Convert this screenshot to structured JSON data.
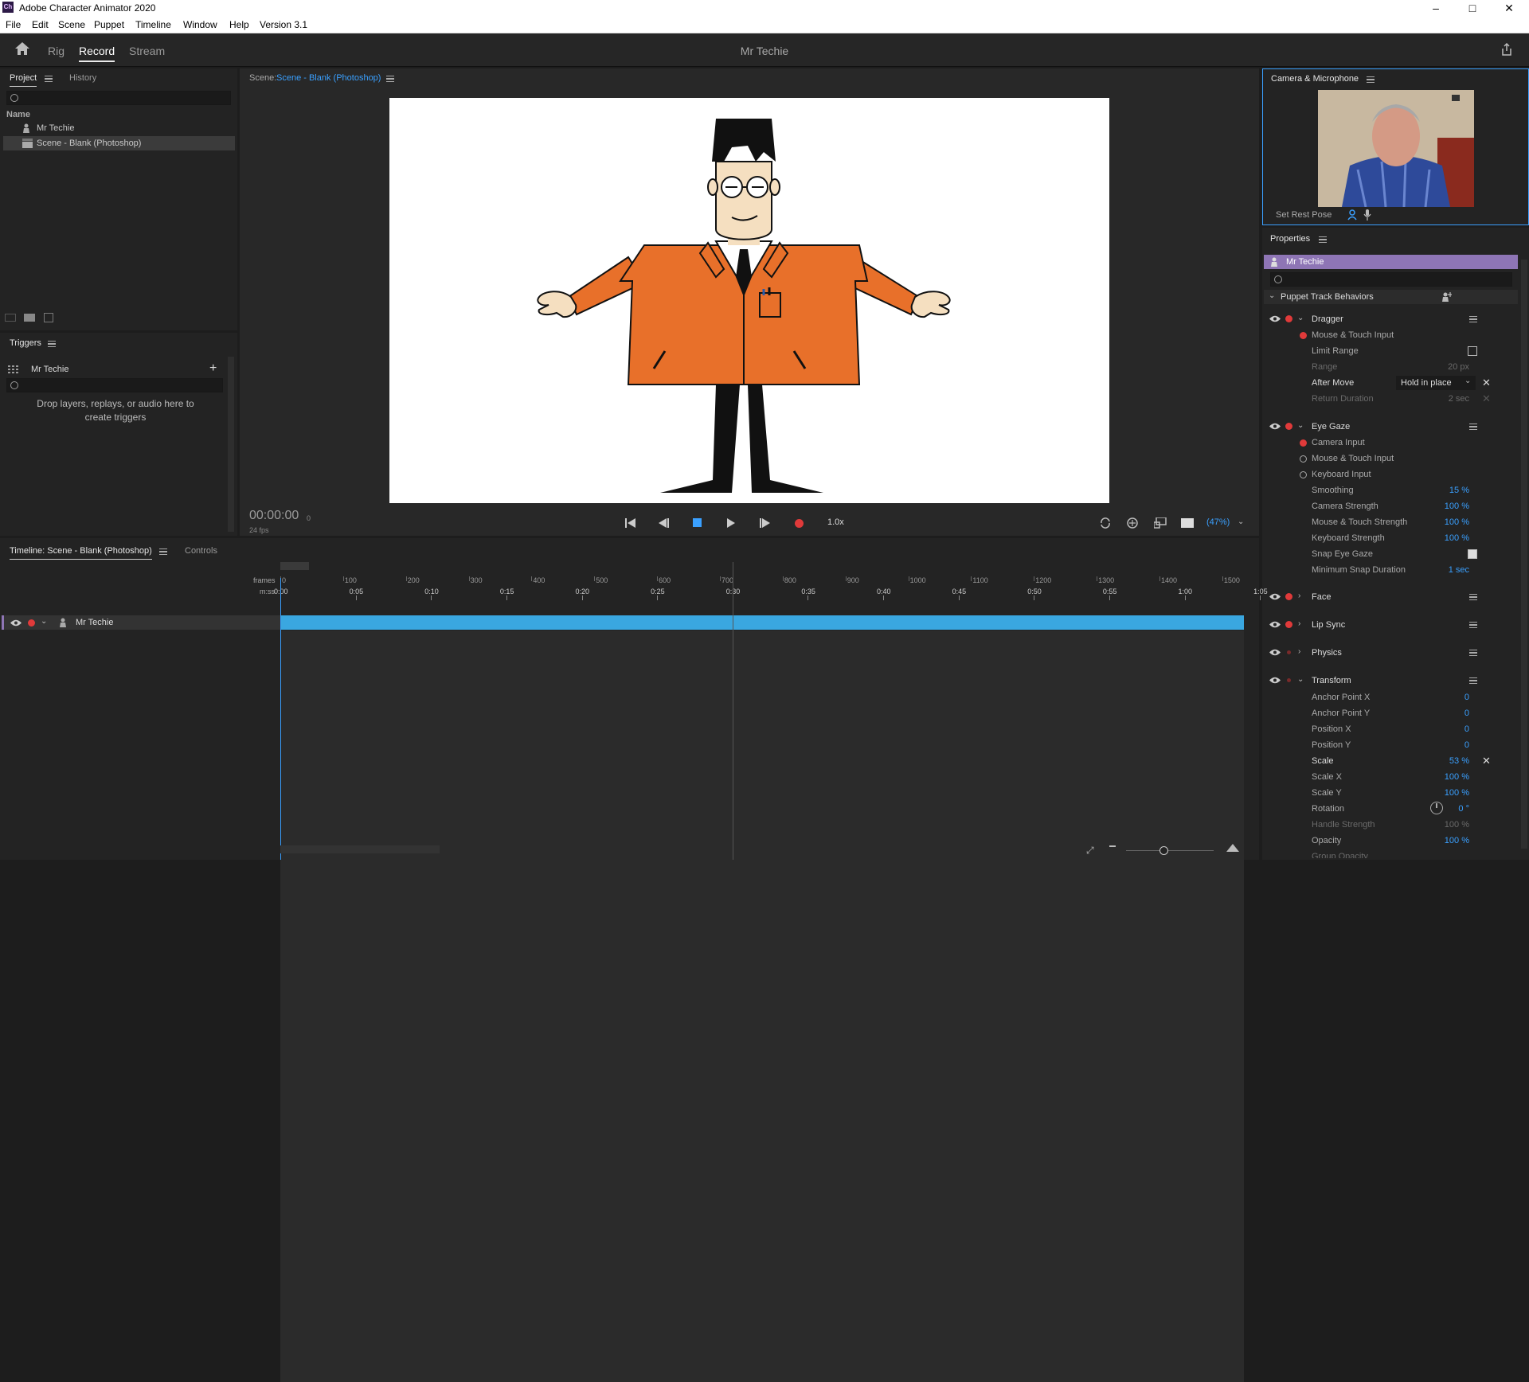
{
  "window": {
    "title": "Adobe Character Animator 2020",
    "app_icon": "Ch",
    "controls": [
      "–",
      "□",
      "✕"
    ]
  },
  "menubar": {
    "items": [
      "File",
      "Edit",
      "Scene",
      "Puppet",
      "Timeline",
      "Window",
      "Help"
    ],
    "version": "Version 3.1"
  },
  "header": {
    "workspaces": [
      "Rig",
      "Record",
      "Stream"
    ],
    "active_workspace": "Record",
    "document_name": "Mr Techie"
  },
  "project_panel": {
    "tabs": [
      "Project",
      "History"
    ],
    "column_name": "Name",
    "items": [
      {
        "label": "Mr Techie",
        "icon": "puppet-icon"
      },
      {
        "label": "Scene - Blank (Photoshop)",
        "icon": "scene-icon",
        "selected": true
      }
    ]
  },
  "triggers_panel": {
    "title": "Triggers",
    "puppet": "Mr Techie",
    "empty_message_line1": "Drop layers, replays, or audio here to",
    "empty_message_line2": "create triggers"
  },
  "scene_panel": {
    "label": "Scene:",
    "scene_name": "Scene - Blank (Photoshop)",
    "timecode": "00:00:00",
    "frame": "0",
    "fps": "24 fps",
    "speed": "1.0x",
    "zoom": "(47%)"
  },
  "camera_panel": {
    "title": "Camera & Microphone",
    "set_rest_pose": "Set Rest Pose"
  },
  "properties_panel": {
    "title": "Properties",
    "puppet": "Mr Techie",
    "section": "Puppet Track Behaviors",
    "dragger": {
      "name": "Dragger",
      "input": "Mouse & Touch Input",
      "limit_range": "Limit Range",
      "range_label": "Range",
      "range_value": "20 px",
      "after_move_label": "After Move",
      "after_move_value": "Hold in place",
      "return_duration_label": "Return Duration",
      "return_duration_value": "2 sec"
    },
    "eye_gaze": {
      "name": "Eye Gaze",
      "camera_input": "Camera Input",
      "mouse_input": "Mouse & Touch Input",
      "keyboard_input": "Keyboard Input",
      "params": [
        {
          "label": "Smoothing",
          "value": "15 %"
        },
        {
          "label": "Camera Strength",
          "value": "100 %"
        },
        {
          "label": "Mouse & Touch Strength",
          "value": "100 %"
        },
        {
          "label": "Keyboard Strength",
          "value": "100 %"
        }
      ],
      "snap_eye_gaze": "Snap Eye Gaze",
      "min_snap_label": "Minimum Snap Duration",
      "min_snap_value": "1 sec"
    },
    "collapsed_behaviors": [
      "Face",
      "Lip Sync",
      "Physics"
    ],
    "transform": {
      "name": "Transform",
      "params": [
        {
          "label": "Anchor Point X",
          "value": "0"
        },
        {
          "label": "Anchor Point Y",
          "value": "0"
        },
        {
          "label": "Position X",
          "value": "0"
        },
        {
          "label": "Position Y",
          "value": "0"
        },
        {
          "label": "Scale",
          "value": "53 %"
        },
        {
          "label": "Scale X",
          "value": "100 %"
        },
        {
          "label": "Scale Y",
          "value": "100 %"
        },
        {
          "label": "Rotation",
          "value": "0 °"
        },
        {
          "label": "Handle Strength",
          "value": "100 %"
        },
        {
          "label": "Opacity",
          "value": "100 %"
        },
        {
          "label": "Group Opacity",
          "value": ""
        }
      ]
    }
  },
  "timeline": {
    "tabs": [
      "Timeline: Scene - Blank (Photoshop)",
      "Controls"
    ],
    "frames_label": "frames",
    "mss_label": "m:ss",
    "frame_ticks": [
      "0",
      "100",
      "200",
      "300",
      "400",
      "500",
      "600",
      "700",
      "800",
      "900",
      "1000",
      "1100",
      "1200",
      "1300",
      "1400",
      "1500"
    ],
    "time_ticks": [
      "0:00",
      "0:05",
      "0:10",
      "0:15",
      "0:20",
      "0:25",
      "0:30",
      "0:35",
      "0:40",
      "0:45",
      "0:50",
      "0:55",
      "1:00",
      "1:05"
    ],
    "track": "Mr Techie",
    "playhead_frame": 0,
    "scene_end_frame": 720
  }
}
